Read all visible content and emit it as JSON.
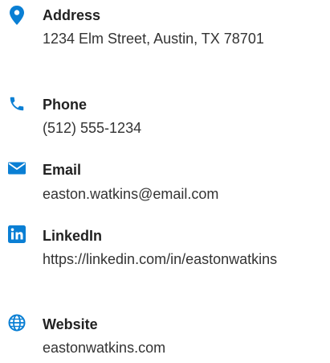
{
  "accent_color": "#0a7fd4",
  "contacts": [
    {
      "icon": "location-pin-icon",
      "label": "Address",
      "value": "1234 Elm Street, Austin, TX 78701"
    },
    {
      "icon": "phone-icon",
      "label": "Phone",
      "value": "(512) 555-1234"
    },
    {
      "icon": "envelope-icon",
      "label": "Email",
      "value": "easton.watkins@email.com"
    },
    {
      "icon": "linkedin-icon",
      "label": "LinkedIn",
      "value": "https://linkedin.com/in/eastonwatkins"
    },
    {
      "icon": "globe-icon",
      "label": "Website",
      "value": "eastonwatkins.com"
    }
  ]
}
